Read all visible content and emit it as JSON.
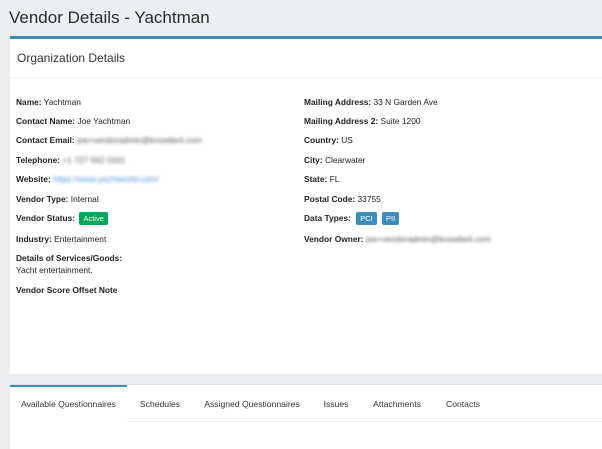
{
  "page": {
    "title": "Vendor Details - Yachtman"
  },
  "card": {
    "title": "Organization Details"
  },
  "fields_left": {
    "name": {
      "label": "Name:",
      "value": "Yachtman"
    },
    "contact_name": {
      "label": "Contact Name:",
      "value": "Joe Yachtman"
    },
    "contact_email": {
      "label": "Contact Email:",
      "value": "joe+vendoradmin@knowbe4.com"
    },
    "telephone": {
      "label": "Telephone:",
      "value": "+1 727 562 0101"
    },
    "website": {
      "label": "Website:",
      "value": "https://www.yachtworld.com/"
    },
    "vendor_type": {
      "label": "Vendor Type:",
      "value": "Internal"
    },
    "vendor_status": {
      "label": "Vendor Status:",
      "value": "Active"
    },
    "industry": {
      "label": "Industry:",
      "value": "Entertainment"
    },
    "services": {
      "label": "Details of Services/Goods:",
      "value": "Yacht entertainment."
    },
    "score_offset": {
      "label": "Vendor Score Offset Note"
    }
  },
  "fields_right": {
    "mailing_address": {
      "label": "Mailing Address:",
      "value": "33 N Garden Ave"
    },
    "mailing_address_2": {
      "label": "Mailing Address 2:",
      "value": "Suite 1200"
    },
    "country": {
      "label": "Country:",
      "value": "US"
    },
    "city": {
      "label": "City:",
      "value": "Clearwater"
    },
    "state": {
      "label": "State:",
      "value": "FL"
    },
    "postal_code": {
      "label": "Postal Code:",
      "value": "33755"
    },
    "data_types": {
      "label": "Data Types:",
      "badges": [
        "PCI",
        "PII"
      ]
    },
    "vendor_owner": {
      "label": "Vendor Owner:",
      "value": "joe+vendoradmin@knowbe4.com"
    }
  },
  "tabs": [
    {
      "label": "Available Questionnaires"
    },
    {
      "label": "Schedules"
    },
    {
      "label": "Assigned Questionnaires"
    },
    {
      "label": "Issues"
    },
    {
      "label": "Attachments"
    },
    {
      "label": "Contacts"
    }
  ],
  "colors": {
    "accent": "#3c8dbc",
    "active_badge": "#00a65a",
    "badge_blue": "#3c8dbc"
  }
}
